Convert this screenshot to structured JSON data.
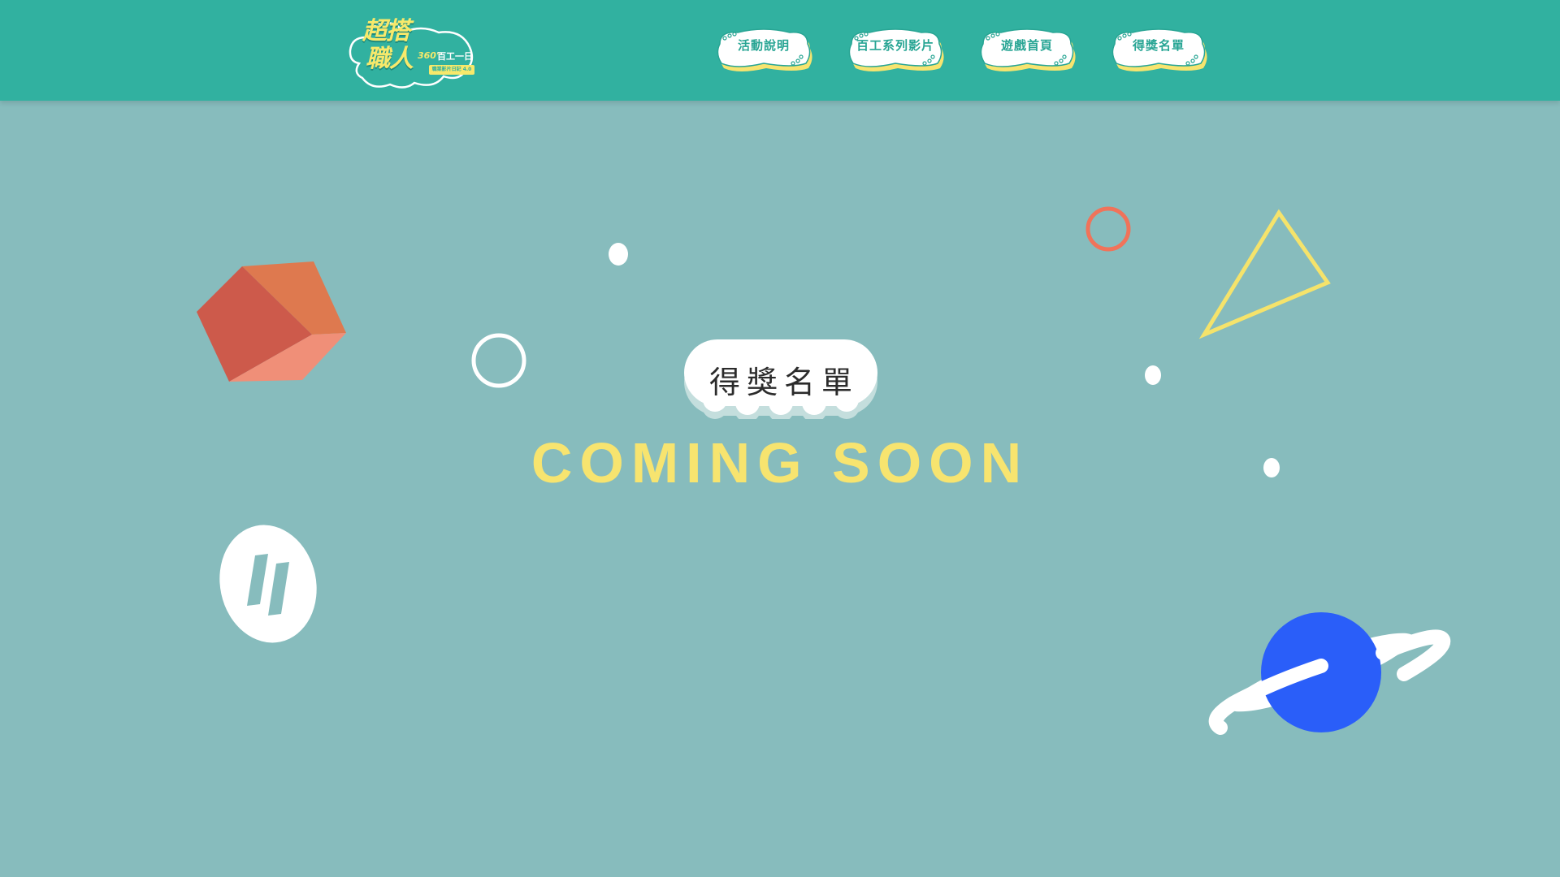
{
  "header": {
    "logo": {
      "line1": "超搭",
      "line2": "職人",
      "number": "360°",
      "subtitle": "百工一日",
      "tag": "職業影片日記 4.0"
    },
    "nav": [
      {
        "label": "活動說明"
      },
      {
        "label": "百工系列影片"
      },
      {
        "label": "遊戲首頁"
      },
      {
        "label": "得獎名單"
      }
    ]
  },
  "main": {
    "title": "得獎名單",
    "status": "COMING SOON"
  },
  "colors": {
    "header_bg": "#31b1a0",
    "page_bg": "#87bcbd",
    "accent_yellow": "#f7e46f",
    "planet_blue": "#2a5ef9",
    "coral": "#f0735a"
  },
  "icons": {
    "cube": "cube-icon",
    "planet": "planet-icon",
    "triangle": "triangle-outline-icon",
    "pause_badge": "pause-icon"
  }
}
